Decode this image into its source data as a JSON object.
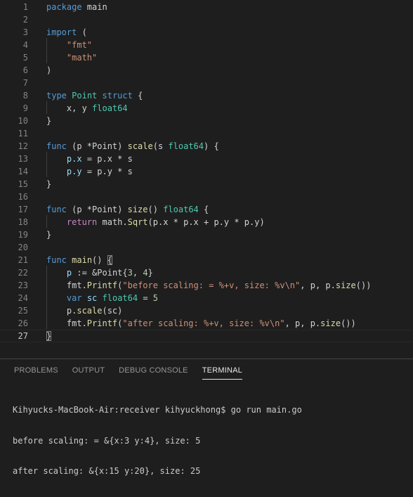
{
  "editor": {
    "current_line": 27,
    "lines": [
      {
        "n": "1",
        "t": [
          [
            "kw",
            "package"
          ],
          [
            "pl",
            " main"
          ]
        ]
      },
      {
        "n": "2",
        "t": []
      },
      {
        "n": "3",
        "t": [
          [
            "kw",
            "import"
          ],
          [
            "pl",
            " ("
          ]
        ]
      },
      {
        "n": "4",
        "t": [
          [
            "pl",
            "    "
          ],
          [
            "st",
            "\"fmt\""
          ]
        ]
      },
      {
        "n": "5",
        "t": [
          [
            "pl",
            "    "
          ],
          [
            "st",
            "\"math\""
          ]
        ]
      },
      {
        "n": "6",
        "t": [
          [
            "pl",
            ")"
          ]
        ]
      },
      {
        "n": "7",
        "t": []
      },
      {
        "n": "8",
        "t": [
          [
            "kw",
            "type"
          ],
          [
            "pl",
            " "
          ],
          [
            "ty",
            "Point"
          ],
          [
            "pl",
            " "
          ],
          [
            "kw",
            "struct"
          ],
          [
            "pl",
            " {"
          ]
        ]
      },
      {
        "n": "9",
        "t": [
          [
            "pl",
            "    x, y "
          ],
          [
            "ty",
            "float64"
          ]
        ]
      },
      {
        "n": "10",
        "t": [
          [
            "pl",
            "}"
          ]
        ]
      },
      {
        "n": "11",
        "t": []
      },
      {
        "n": "12",
        "t": [
          [
            "kw",
            "func"
          ],
          [
            "pl",
            " (p *Point) "
          ],
          [
            "fn",
            "scale"
          ],
          [
            "pl",
            "(s "
          ],
          [
            "ty",
            "float64"
          ],
          [
            "pl",
            ") {"
          ]
        ]
      },
      {
        "n": "13",
        "t": [
          [
            "pl",
            "    "
          ],
          [
            "va",
            "p.x"
          ],
          [
            "pl",
            " = p.x * s"
          ]
        ]
      },
      {
        "n": "14",
        "t": [
          [
            "pl",
            "    "
          ],
          [
            "va",
            "p.y"
          ],
          [
            "pl",
            " = p.y * s"
          ]
        ]
      },
      {
        "n": "15",
        "t": [
          [
            "pl",
            "}"
          ]
        ]
      },
      {
        "n": "16",
        "t": []
      },
      {
        "n": "17",
        "t": [
          [
            "kw",
            "func"
          ],
          [
            "pl",
            " (p *Point) "
          ],
          [
            "fn",
            "size"
          ],
          [
            "pl",
            "() "
          ],
          [
            "ty",
            "float64"
          ],
          [
            "pl",
            " {"
          ]
        ]
      },
      {
        "n": "18",
        "t": [
          [
            "pl",
            "    "
          ],
          [
            "ctl",
            "return"
          ],
          [
            "pl",
            " math."
          ],
          [
            "fn",
            "Sqrt"
          ],
          [
            "pl",
            "(p.x * p.x + p.y * p.y)"
          ]
        ]
      },
      {
        "n": "19",
        "t": [
          [
            "pl",
            "}"
          ]
        ]
      },
      {
        "n": "20",
        "t": []
      },
      {
        "n": "21",
        "t": [
          [
            "kw",
            "func"
          ],
          [
            "pl",
            " "
          ],
          [
            "fn",
            "main"
          ],
          [
            "pl",
            "() "
          ],
          [
            "br",
            "{"
          ]
        ]
      },
      {
        "n": "22",
        "t": [
          [
            "pl",
            "    "
          ],
          [
            "va",
            "p"
          ],
          [
            "pl",
            " := &Point{"
          ],
          [
            "nu",
            "3"
          ],
          [
            "pl",
            ", "
          ],
          [
            "nu",
            "4"
          ],
          [
            "pl",
            "}"
          ]
        ]
      },
      {
        "n": "23",
        "t": [
          [
            "pl",
            "    fmt."
          ],
          [
            "fn",
            "Printf"
          ],
          [
            "pl",
            "("
          ],
          [
            "st",
            "\"before scaling: = %+v, size: %v\\n\""
          ],
          [
            "pl",
            ", p, p."
          ],
          [
            "fn",
            "size"
          ],
          [
            "pl",
            "())"
          ]
        ]
      },
      {
        "n": "24",
        "t": [
          [
            "pl",
            "    "
          ],
          [
            "kw",
            "var"
          ],
          [
            "pl",
            " "
          ],
          [
            "va",
            "sc"
          ],
          [
            "pl",
            " "
          ],
          [
            "ty",
            "float64"
          ],
          [
            "pl",
            " = "
          ],
          [
            "nu",
            "5"
          ]
        ]
      },
      {
        "n": "25",
        "t": [
          [
            "pl",
            "    p."
          ],
          [
            "fn",
            "scale"
          ],
          [
            "pl",
            "(sc)"
          ]
        ]
      },
      {
        "n": "26",
        "t": [
          [
            "pl",
            "    fmt."
          ],
          [
            "fn",
            "Printf"
          ],
          [
            "pl",
            "("
          ],
          [
            "st",
            "\"after scaling: %+v, size: %v\\n\""
          ],
          [
            "pl",
            ", p, p."
          ],
          [
            "fn",
            "size"
          ],
          [
            "pl",
            "())"
          ]
        ]
      },
      {
        "n": "27",
        "t": [
          [
            "br",
            "}"
          ]
        ]
      }
    ]
  },
  "panel": {
    "tabs": [
      "PROBLEMS",
      "OUTPUT",
      "DEBUG CONSOLE",
      "TERMINAL"
    ],
    "active_tab": "TERMINAL",
    "terminal": [
      "Kihyucks-MacBook-Air:receiver kihyuckhong$ go run main.go",
      "before scaling: = &{x:3 y:4}, size: 5",
      "after scaling: &{x:15 y:20}, size: 25"
    ]
  },
  "colors": {
    "background": "#1e1e1e",
    "keyword": "#569cd6",
    "type": "#4ec9b0",
    "string": "#ce9178",
    "function": "#dcdcaa",
    "variable": "#9cdcfe",
    "number": "#b5cea8",
    "control": "#c586c0"
  }
}
